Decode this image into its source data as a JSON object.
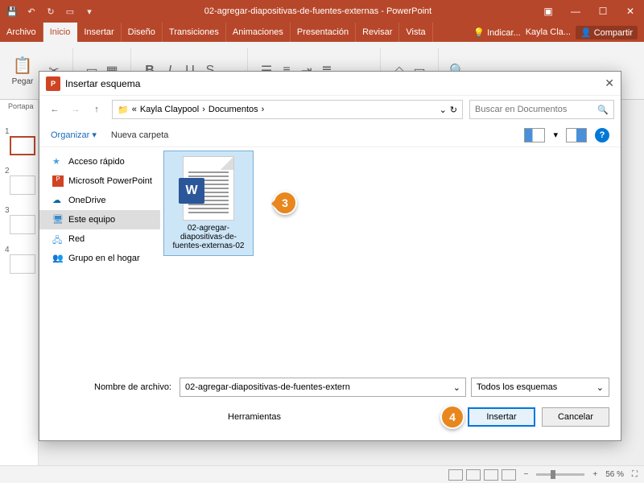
{
  "titlebar": {
    "title": "02-agregar-diapositivas-de-fuentes-externas - PowerPoint"
  },
  "ribbon": {
    "tabs": [
      "Archivo",
      "Inicio",
      "Insertar",
      "Diseño",
      "Transiciones",
      "Animaciones",
      "Presentación",
      "Revisar",
      "Vista"
    ],
    "tell_me": "Indicar...",
    "user": "Kayla Cla...",
    "share": "Compartir",
    "paste_label": "Pegar",
    "portapap": "Portapa"
  },
  "slides": [
    1,
    2,
    3,
    4
  ],
  "statusbar": {
    "zoom": "56 %"
  },
  "dialog": {
    "title": "Insertar esquema",
    "breadcrumb": [
      "Kayla Claypool",
      "Documentos"
    ],
    "search_placeholder": "Buscar en Documentos",
    "organize": "Organizar",
    "new_folder": "Nueva carpeta",
    "sidebar": [
      {
        "label": "Acceso rápido",
        "color": "#4aa0e0"
      },
      {
        "label": "Microsoft PowerPoint",
        "color": "#d04423"
      },
      {
        "label": "OneDrive",
        "color": "#0a64a4"
      },
      {
        "label": "Este equipo",
        "color": "#3a88c9",
        "selected": true
      },
      {
        "label": "Red",
        "color": "#4aa0e0"
      },
      {
        "label": "Grupo en el hogar",
        "color": "#3cb371"
      }
    ],
    "file": {
      "name": "02-agregar-diapositivas-de-fuentes-externas-02"
    },
    "footer": {
      "filename_label": "Nombre de archivo:",
      "filename_value": "02-agregar-diapositivas-de-fuentes-extern",
      "filetype": "Todos los esquemas",
      "tools": "Herramientas",
      "insert": "Insertar",
      "cancel": "Cancelar"
    }
  },
  "callouts": {
    "c3": "3",
    "c4": "4"
  }
}
